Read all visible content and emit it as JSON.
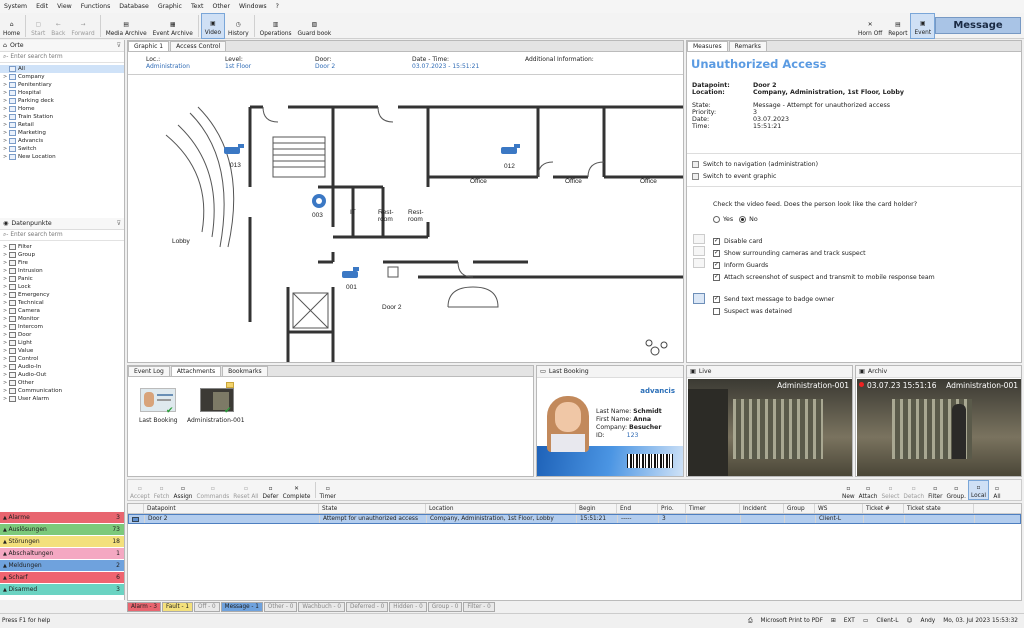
{
  "menu": [
    "System",
    "Edit",
    "View",
    "Functions",
    "Database",
    "Graphic",
    "Text",
    "Other",
    "Windows",
    "?"
  ],
  "toolbar": {
    "items": [
      {
        "label": "Home",
        "icon": "home-icon",
        "disabled": false
      },
      {
        "label": "Start",
        "icon": "start-icon",
        "disabled": true
      },
      {
        "label": "Back",
        "icon": "back-icon",
        "disabled": true
      },
      {
        "label": "Forward",
        "icon": "forward-icon",
        "disabled": true
      },
      {
        "label": "Media Archive",
        "icon": "media-archive-icon",
        "disabled": false
      },
      {
        "label": "Event Archive",
        "icon": "event-archive-icon",
        "disabled": false
      },
      {
        "label": "Video",
        "icon": "video-icon",
        "disabled": false,
        "active": true
      },
      {
        "label": "History",
        "icon": "history-icon",
        "disabled": false
      },
      {
        "label": "Operations",
        "icon": "operations-icon",
        "disabled": false
      },
      {
        "label": "Guard book",
        "icon": "guard-book-icon",
        "disabled": false
      }
    ],
    "right": [
      {
        "label": "Horn Off",
        "icon": "horn-off-icon"
      },
      {
        "label": "Report",
        "icon": "report-icon"
      },
      {
        "label": "Event",
        "icon": "event-icon"
      }
    ],
    "message_label": "Message"
  },
  "orte": {
    "title": "Orte",
    "search_placeholder": "Enter search term",
    "items": [
      "All",
      "Company",
      "Penitentiary",
      "Hospital",
      "Parking deck",
      "Home",
      "Train Station",
      "Retail",
      "Marketing",
      "Advancis",
      "Switch",
      "New Location"
    ]
  },
  "datapoints": {
    "title": "Datenpunkte",
    "search_placeholder": "Enter search term",
    "items": [
      "Filter",
      "Group",
      "Fire",
      "Intrusion",
      "Panic",
      "Lock",
      "Emergency",
      "Technical",
      "Camera",
      "Monitor",
      "Intercom",
      "Door",
      "Light",
      "Value",
      "Control",
      "Audio-In",
      "Audio-Out",
      "Other",
      "Communication",
      "User Alarm"
    ]
  },
  "alarm_groups": [
    {
      "label": "Alarme",
      "count": "3",
      "color": "#e8656f"
    },
    {
      "label": "Auslösungen",
      "count": "73",
      "color": "#7cc97b"
    },
    {
      "label": "Störungen",
      "count": "18",
      "color": "#f3e07c"
    },
    {
      "label": "Abschaltungen",
      "count": "1",
      "color": "#f4a8c2"
    },
    {
      "label": "Meldungen",
      "count": "2",
      "color": "#6fa2dd"
    },
    {
      "label": "Scharf",
      "count": "6",
      "color": "#ef6470"
    },
    {
      "label": "Disarmed",
      "count": "3",
      "color": "#6bd3c2"
    }
  ],
  "graphic": {
    "tabs": [
      "Graphic 1",
      "Access Control"
    ],
    "info": {
      "loc_label": "Loc.:",
      "loc_value": "Administration",
      "level_label": "Level:",
      "level_value": "1st Floor",
      "door_label": "Door:",
      "door_value": "Door 2",
      "date_label": "Date - Time:",
      "date_value": "03.07.2023 - 15:51:21",
      "addinfo_label": "Additional Information:"
    },
    "rooms": [
      "Office",
      "Office",
      "Office",
      "IT",
      "Rest-",
      "room",
      "Rest-",
      "room",
      "Lobby",
      "Door 2"
    ],
    "cameras": [
      "013",
      "012",
      "003",
      "001"
    ]
  },
  "measures": {
    "tabs": [
      "Measures",
      "Remarks"
    ],
    "title": "Unauthorized Access",
    "datapoint_label": "Datapoint:",
    "datapoint": "Door 2",
    "location_label": "Location:",
    "location": "Company, Administration, 1st Floor, Lobby",
    "state_label": "State:",
    "state": "Message - Attempt for unauthorized access",
    "priority_label": "Priority:",
    "priority": "3",
    "date_label": "Date:",
    "date": "03.07.2023",
    "time_label": "Time:",
    "time": "15:51:21",
    "links": [
      "Switch to navigation (administration)",
      "Switch to event graphic"
    ],
    "question": "Check the video feed. Does the person look like the card holder?",
    "yes": "Yes",
    "no": "No",
    "checks": [
      {
        "label": "Disable card",
        "checked": true
      },
      {
        "label": "Show surrounding cameras and track suspect",
        "checked": true
      },
      {
        "label": "Inform Guards",
        "checked": true
      },
      {
        "label": "Attach screenshot of suspect and transmit to mobile response team",
        "checked": true
      },
      {
        "label": "Send text message to badge owner",
        "checked": true
      },
      {
        "label": "Suspect was detained",
        "checked": false
      }
    ]
  },
  "attachments": {
    "tabs": [
      "Event Log",
      "Attachments",
      "Bookmarks"
    ],
    "items": [
      "Last Booking",
      "Administration-001"
    ]
  },
  "last_booking": {
    "title": "Last Booking",
    "brand": "advancis",
    "last_name_label": "Last Name:",
    "last_name": "Schmidt",
    "first_name_label": "First Name:",
    "first_name": "Anna",
    "company_label": "Company:",
    "company": "Besucher",
    "id_label": "ID:",
    "id": "123"
  },
  "live": {
    "title": "Live",
    "overlay": "Administration-001"
  },
  "archiv": {
    "title": "Archiv",
    "overlay_time": "03.07.23 15:51:16",
    "overlay_name": "Administration-001"
  },
  "event_toolbar": {
    "left": [
      {
        "label": "Accept",
        "disabled": true
      },
      {
        "label": "Fetch",
        "disabled": true
      },
      {
        "label": "Assign",
        "disabled": false
      },
      {
        "label": "Commands",
        "disabled": true
      },
      {
        "label": "Reset All",
        "disabled": true
      },
      {
        "label": "Defer",
        "disabled": false
      },
      {
        "label": "Complete",
        "disabled": false
      },
      {
        "label": "Timer",
        "disabled": false
      }
    ],
    "right": [
      {
        "label": "New",
        "disabled": false
      },
      {
        "label": "Attach",
        "disabled": false
      },
      {
        "label": "Select",
        "disabled": true
      },
      {
        "label": "Detach",
        "disabled": true
      },
      {
        "label": "Filter",
        "disabled": false
      },
      {
        "label": "Group.",
        "disabled": false
      },
      {
        "label": "Local",
        "disabled": false
      },
      {
        "label": "All",
        "disabled": false
      }
    ]
  },
  "event_table": {
    "columns": [
      "Datapoint",
      "State",
      "Location",
      "Begin",
      "End",
      "Prio.",
      "Timer",
      "Incident",
      "Group",
      "WS",
      "Ticket #",
      "Ticket state"
    ],
    "rows": [
      [
        "Door 2",
        "Attempt for unauthorized access",
        "Company, Administration, 1st Floor, Lobby",
        "15:51:21",
        "-----",
        "3",
        "",
        "",
        "",
        "Client-L",
        "",
        ""
      ]
    ]
  },
  "filter_tabs": [
    {
      "label": "Alarm - 3",
      "color": "#e8656f"
    },
    {
      "label": "Fault - 1",
      "color": "#f3e07c"
    },
    {
      "label": "Off - 0",
      "color": "#e9e9e9"
    },
    {
      "label": "Message - 1",
      "color": "#6fa2dd"
    },
    {
      "label": "Other - 0",
      "color": "#e9e9e9"
    },
    {
      "label": "Wachbuch - 0",
      "color": "#e9e9e9"
    },
    {
      "label": "Deferred - 0",
      "color": "#e9e9e9"
    },
    {
      "label": "Hidden - 0",
      "color": "#e9e9e9"
    },
    {
      "label": "Group - 0",
      "color": "#e9e9e9"
    },
    {
      "label": "Filter - 0",
      "color": "#e9e9e9"
    }
  ],
  "status": {
    "help": "Press F1 for help",
    "printer": "Microsoft Print to PDF",
    "ext": "EXT",
    "client": "Client-L",
    "user": "Andy",
    "datetime": "Mo, 03. Jul 2023 15:53:32"
  }
}
